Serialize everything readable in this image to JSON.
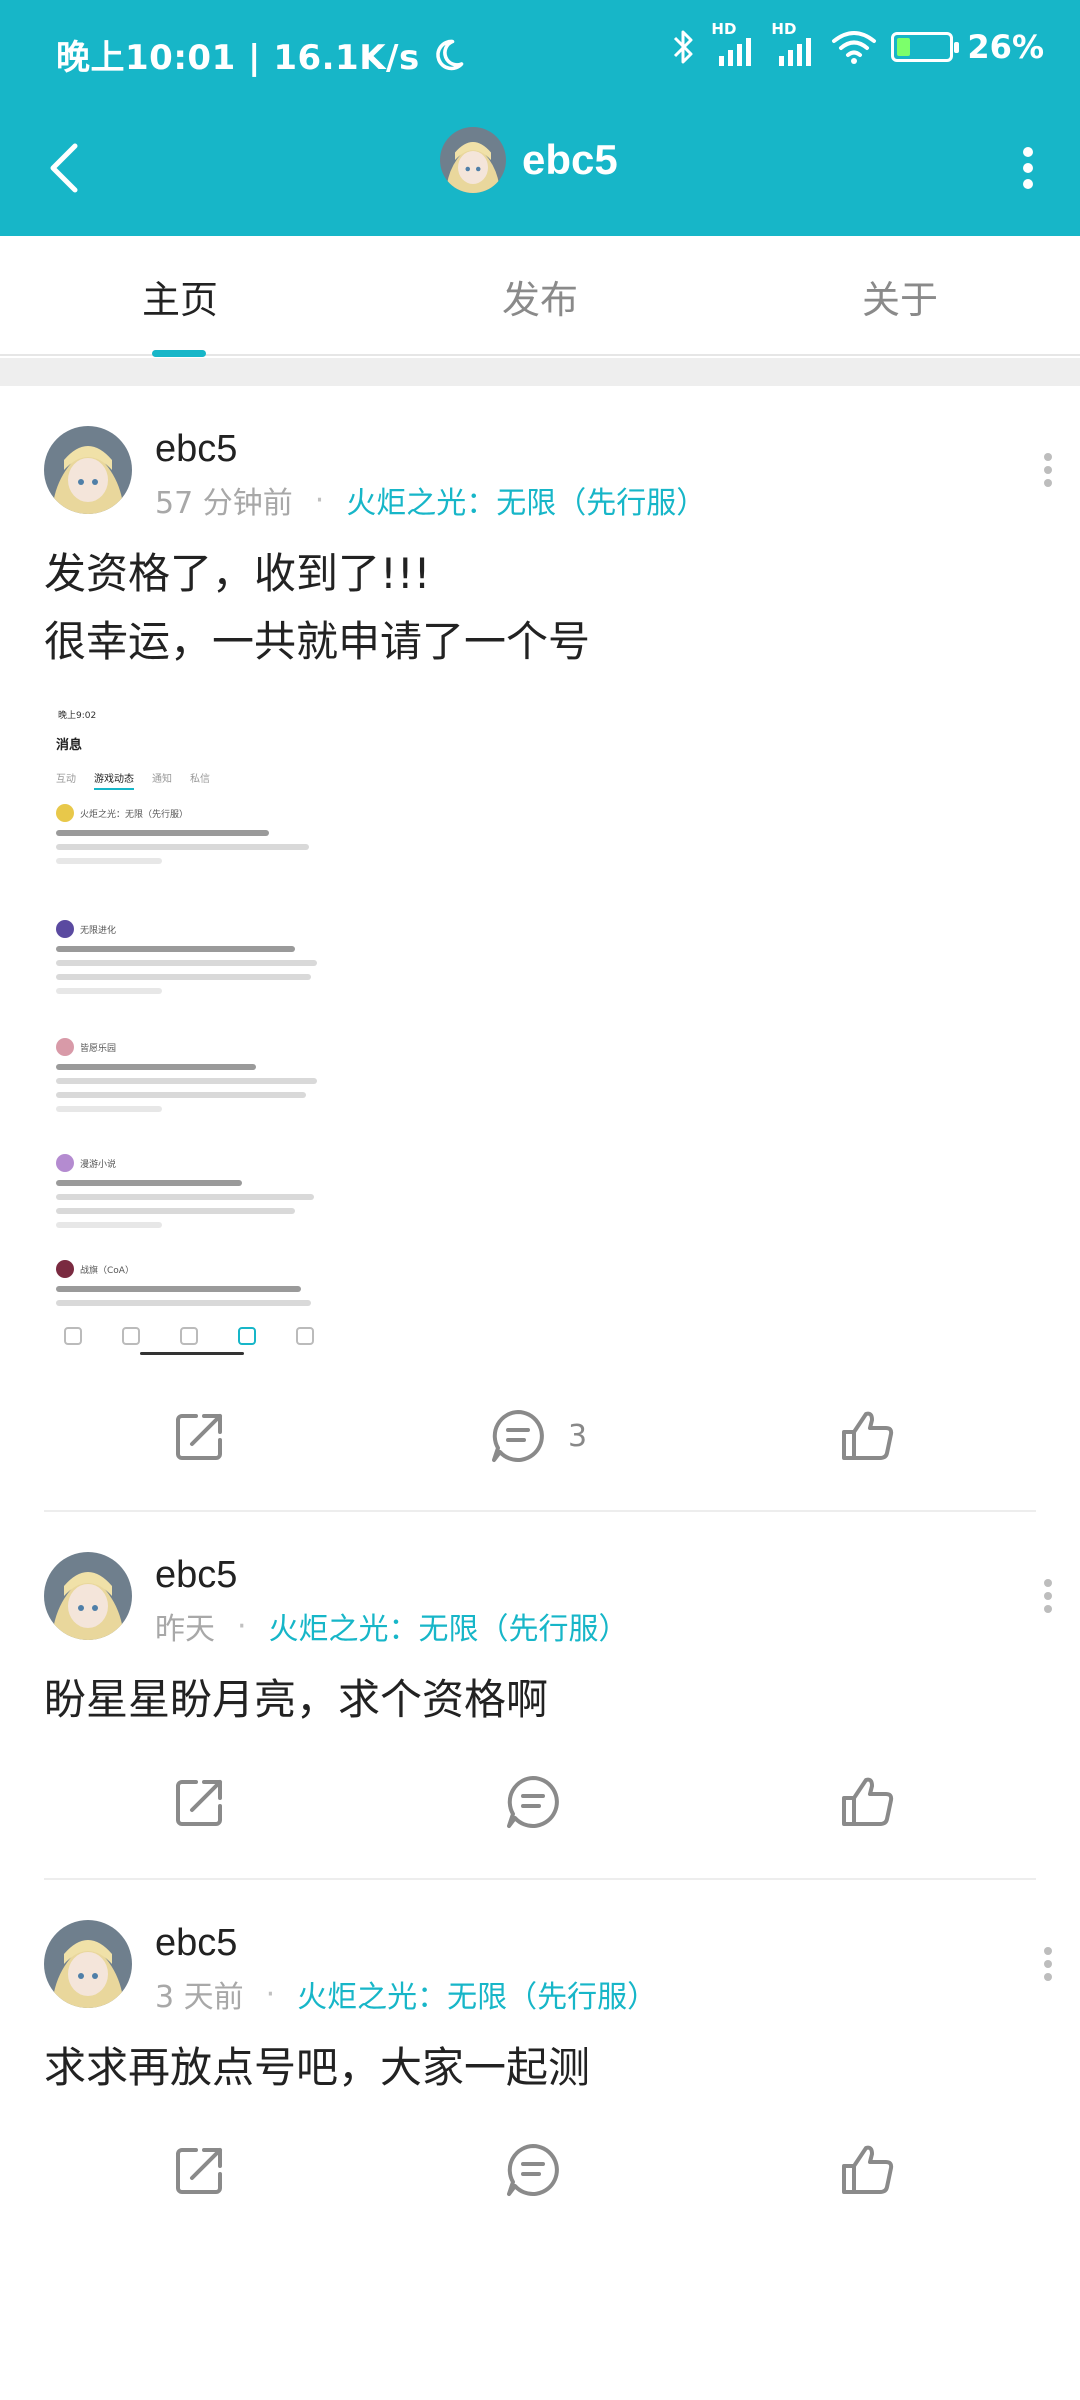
{
  "status_bar": {
    "time": "晚上10:01 | 16.1K/s",
    "signal_1_label": "HD",
    "signal_2_label": "HD",
    "battery_text": "26%",
    "battery_level": 0.26
  },
  "app_bar": {
    "title": "ebc5"
  },
  "tabs": [
    {
      "label": "主页",
      "active": true
    },
    {
      "label": "发布",
      "active": false
    },
    {
      "label": "关于",
      "active": false
    }
  ],
  "posts": [
    {
      "username": "ebc5",
      "time": "57 分钟前",
      "separator": "·",
      "game": "火炬之光：无限（先行服）",
      "text_line1": "发资格了，收到了!!!",
      "text_line2": "很幸运，一共就申请了一个号",
      "comment_count": "3"
    },
    {
      "username": "ebc5",
      "time": "昨天",
      "separator": "·",
      "game": "火炬之光：无限（先行服）",
      "text_line1": "盼星星盼月亮，求个资格啊"
    },
    {
      "username": "ebc5",
      "time": "3 天前",
      "separator": "·",
      "game": "火炬之光：无限（先行服）",
      "text_line1": "求求再放点号吧，大家一起测"
    }
  ],
  "embedded_screenshot": {
    "status_time": "晚上9:02",
    "title": "消息",
    "tabs": [
      "互动",
      "游戏动态",
      "通知",
      "私信"
    ],
    "items": [
      "火炬之光：无限（先行服）",
      "无限进化",
      "皆愿乐园",
      "漫游小说",
      "战旗（CoA）"
    ]
  },
  "colors": {
    "accent": "#17B6C8",
    "text_primary": "#222222",
    "text_secondary": "#A8A8A8",
    "icon_gray": "#8A8A8A"
  },
  "icons": [
    "back-arrow-icon",
    "more-vertical-icon",
    "share-icon",
    "comment-icon",
    "thumbs-up-icon",
    "bluetooth-icon",
    "wifi-icon",
    "moon-icon"
  ]
}
